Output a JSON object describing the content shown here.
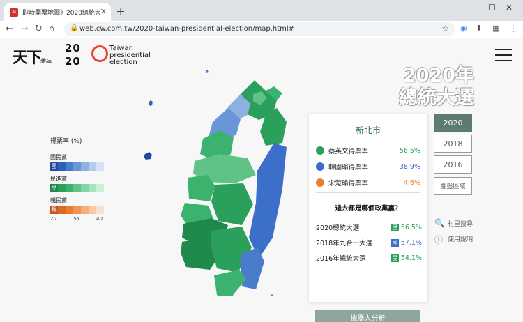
{
  "browser": {
    "tab_title": "即時開票地圖》2020總統大選",
    "tab_favicon": "Ai",
    "url": "web.cw.com.tw/2020-taiwan-presidential-election/map.html#"
  },
  "header": {
    "logo_main": "天下",
    "logo_sub": "雜誌",
    "logo_year_top": "20",
    "logo_year_bottom": "20",
    "logo_text": "Taiwan presidential election",
    "big_title_line1": "2020年",
    "big_title_line2": "總統大選"
  },
  "legend": {
    "heading": "得票率 (%)",
    "parties": [
      {
        "name": "國民黨",
        "badge": "國",
        "colors": [
          "#1f4b9e",
          "#2f5fb8",
          "#4a7ccc",
          "#6a96d8",
          "#8db0e3",
          "#b3cbee",
          "#d6e3f6"
        ]
      },
      {
        "name": "民進黨",
        "badge": "民",
        "colors": [
          "#1f8a4c",
          "#2aa05c",
          "#3bb36e",
          "#5fc388",
          "#84d3a3",
          "#a8e2bd",
          "#ccefd9"
        ]
      },
      {
        "name": "親民黨",
        "badge": "親",
        "colors": [
          "#c2571a",
          "#d96a22",
          "#ea7d30",
          "#f29352",
          "#f6ad7a",
          "#f9c8a3",
          "#fce0cc"
        ]
      }
    ],
    "ticks": [
      "70",
      "55",
      "40"
    ]
  },
  "panel": {
    "city": "新北市",
    "candidates": [
      {
        "label": "蔡英文得票率",
        "value": "56.5%",
        "color": "#2aa05c"
      },
      {
        "label": "韓國瑜得票率",
        "value": "38.9%",
        "color": "#3b6fc9"
      },
      {
        "label": "宋楚瑜得票率",
        "value": "4.6%",
        "color": "#ea7d30"
      }
    ],
    "question": "過去都是哪個政黨贏？",
    "history": [
      {
        "label": "2020總統大選",
        "badge": "民",
        "value": "56.5%",
        "color": "#2aa05c"
      },
      {
        "label": "2018年九合一大選",
        "badge": "國",
        "value": "57.1%",
        "color": "#3b6fc9"
      },
      {
        "label": "2016年總統大選",
        "badge": "民",
        "value": "54.1%",
        "color": "#2aa05c"
      }
    ],
    "robot_button": "機器人分析"
  },
  "years": [
    "2020",
    "2018",
    "2016",
    "翻盤區域"
  ],
  "tools": {
    "search": "村里搜尋",
    "help": "使用說明"
  }
}
